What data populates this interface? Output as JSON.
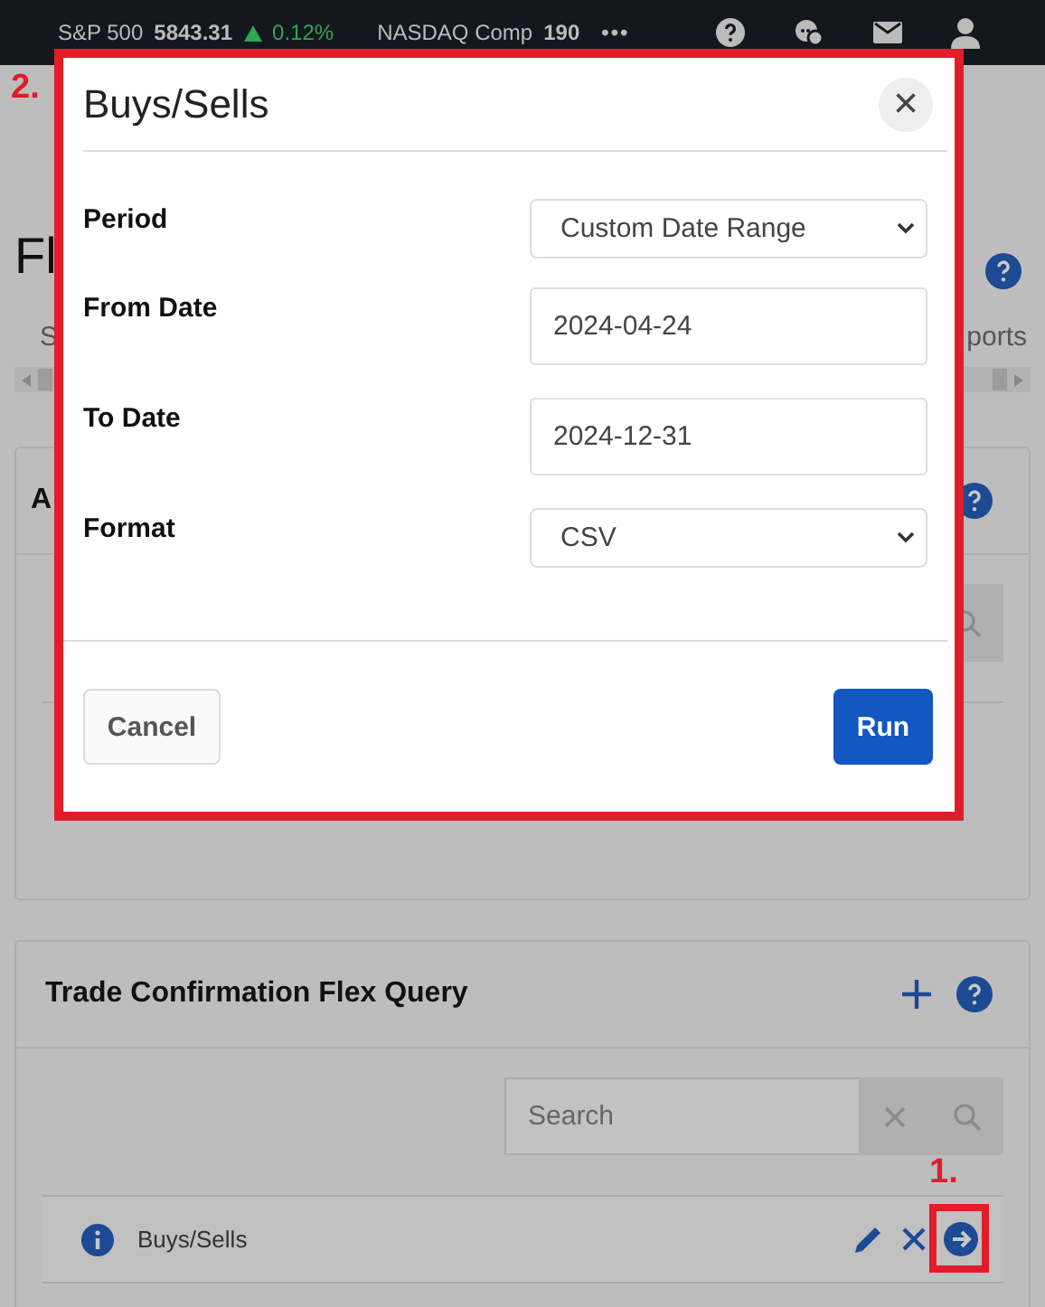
{
  "top_bar": {
    "tickers": [
      {
        "name": "S&P 500",
        "value": "5843.31",
        "change": "0.12%"
      },
      {
        "name": "NASDAQ Comp",
        "value": "190"
      }
    ],
    "more": "•••"
  },
  "page": {
    "title": "Fl",
    "tabs": [
      {
        "label": "S"
      },
      {
        "label": "ports"
      }
    ],
    "sections": [
      {
        "title": "A"
      },
      {
        "title": "Trade Confirmation Flex Query",
        "search": {
          "placeholder": "Search"
        },
        "rows": [
          {
            "name": "Buys/Sells",
            "annotation": "1."
          }
        ]
      }
    ]
  },
  "dialog": {
    "annotation": "2.",
    "title": "Buys/Sells",
    "close": "×",
    "fields": [
      {
        "label": "Period",
        "kind": "select",
        "value": "Custom Date Range"
      },
      {
        "label": "From Date",
        "kind": "text",
        "value": "2024-04-24"
      },
      {
        "label": "To Date",
        "kind": "text",
        "value": "2024-12-31"
      },
      {
        "label": "Format",
        "kind": "select",
        "value": "CSV"
      }
    ],
    "buttons": [
      {
        "label": "Cancel",
        "kind": "secondary"
      },
      {
        "label": "Run",
        "kind": "primary"
      }
    ]
  }
}
